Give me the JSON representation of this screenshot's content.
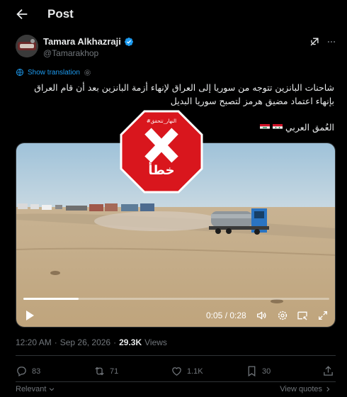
{
  "header": {
    "title": "Post"
  },
  "author": {
    "name": "Tamara Alkhazraji",
    "handle": "@Tamarakhop"
  },
  "translation": {
    "label": "Show translation"
  },
  "tweet": {
    "text": "شاحنات البانزين تتوجه من سوريا إلى العراق لإنهاء أزمة البانزين بعد أن قام العراق بإنهاء اعتماد مضيق هرمز لتصبح سوريا البديل",
    "source": "العُمق العربي"
  },
  "stamp": {
    "label": "خطأ",
    "tag": "#النهار_تتحقق"
  },
  "video": {
    "current_time": "0:05",
    "duration": "0:28",
    "progress": 0.18
  },
  "meta": {
    "time": "12:20 AM",
    "date": "Sep 26, 2026",
    "views_count": "29.3K",
    "views_label": "Views",
    "separator": "·"
  },
  "actions": {
    "replies": "83",
    "reposts": "71",
    "likes": "1.1K",
    "bookmarks": "30"
  },
  "footer": {
    "sort": "Relevant",
    "view_quotes": "View quotes"
  },
  "colors": {
    "accent": "#1d9bf0",
    "stamp_red": "#d9161d",
    "background": "#000000",
    "muted": "#71767b"
  }
}
